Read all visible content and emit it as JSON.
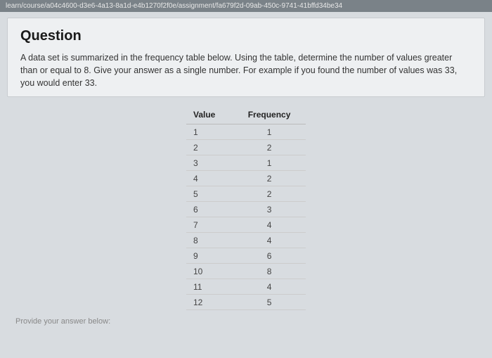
{
  "url_fragment": "learn/course/a04c4600-d3e6-4a13-8a1d-e4b1270f2f0e/assignment/fa679f2d-09ab-450c-9741-41bffd34be34",
  "question": {
    "heading": "Question",
    "prompt": "A data set is summarized in the frequency table below. Using the table, determine the number of values greater than or equal to 8. Give your answer as a single number. For example if you found the number of values was 33, you would enter 33."
  },
  "table": {
    "headers": {
      "value": "Value",
      "frequency": "Frequency"
    },
    "rows": [
      {
        "value": "1",
        "frequency": "1"
      },
      {
        "value": "2",
        "frequency": "2"
      },
      {
        "value": "3",
        "frequency": "1"
      },
      {
        "value": "4",
        "frequency": "2"
      },
      {
        "value": "5",
        "frequency": "2"
      },
      {
        "value": "6",
        "frequency": "3"
      },
      {
        "value": "7",
        "frequency": "4"
      },
      {
        "value": "8",
        "frequency": "4"
      },
      {
        "value": "9",
        "frequency": "6"
      },
      {
        "value": "10",
        "frequency": "8"
      },
      {
        "value": "11",
        "frequency": "4"
      },
      {
        "value": "12",
        "frequency": "5"
      }
    ]
  },
  "answer_label": "Provide your answer below:"
}
